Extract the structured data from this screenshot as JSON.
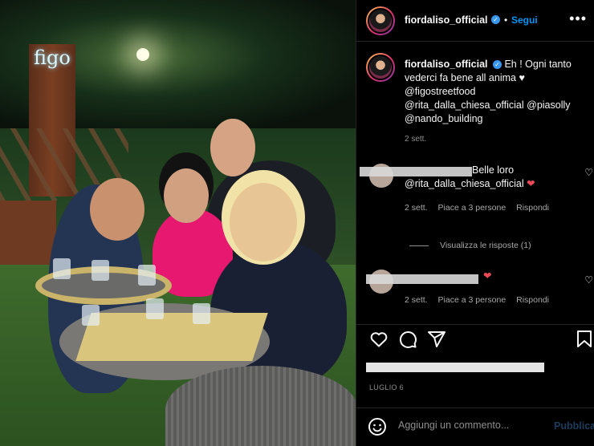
{
  "photo": {
    "sign_text": "figo"
  },
  "header": {
    "username": "fiordaliso_official",
    "verified_icon": "verified-badge-icon",
    "follow_label": "Segui",
    "more_icon": "more-options-icon",
    "dot": "•"
  },
  "caption": {
    "username": "fiordaliso_official",
    "text": "Eh ! Ogni tanto vederci fa bene all anima ♥ @figostreetfood @rita_dalla_chiesa_official @piasolly @nando_building",
    "time": "2 sett."
  },
  "comments": [
    {
      "text": "Belle loro @rita_dalla_chiesa_official",
      "heart": "❤",
      "time": "2 sett.",
      "likes": "Piace a 3 persone",
      "reply": "Rispondi"
    },
    {
      "text": "",
      "heart": "❤",
      "time": "2 sett.",
      "likes": "Piace a 3 persone",
      "reply": "Rispondi"
    }
  ],
  "replies_label": "Visualizza le risposte (1)",
  "actions": {
    "like_icon": "heart-icon",
    "comment_icon": "comment-icon",
    "share_icon": "send-icon",
    "save_icon": "bookmark-icon"
  },
  "date": "LUGLIO 6",
  "add_comment": {
    "placeholder": "Aggiungi un commento...",
    "publish_label": "Pubblica",
    "emoji_icon": "emoji-icon"
  },
  "colors": {
    "accent": "#0095f6",
    "verified": "#3897f0",
    "heart": "#ed4956",
    "background": "#000000"
  }
}
